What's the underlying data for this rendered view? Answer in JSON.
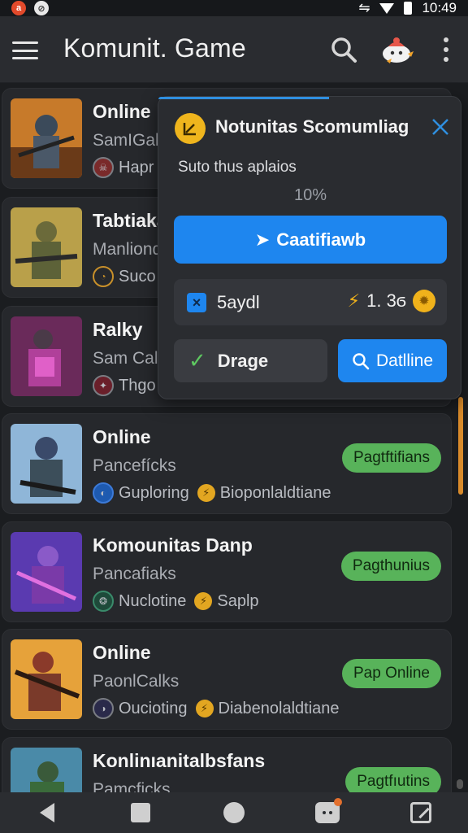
{
  "status_bar": {
    "time": "10:49"
  },
  "app_bar": {
    "title": "Komunit. Game",
    "icons": [
      "menu-icon",
      "search-icon",
      "mascot-icon",
      "more-vert-icon"
    ]
  },
  "cards": [
    {
      "title": "Online",
      "subtitle": "SamIGak",
      "meta": "Hapr",
      "status": ""
    },
    {
      "title": "Tabtiaka",
      "subtitle": "Manliond",
      "meta": "Suco",
      "status": ""
    },
    {
      "title": "Ralky",
      "subtitle": "Sam Cal",
      "meta": "Thgo",
      "status": ""
    },
    {
      "title": "Online",
      "subtitle": "Pancefícks",
      "meta": "Guploring",
      "meta2": "Bioponlaldtiane",
      "status": "Pagtftifians"
    },
    {
      "title": "Komounitas Danp",
      "subtitle": "Pancafiaks",
      "meta": "Nuclotine",
      "meta2": "Saplp",
      "status": "Pagthunius"
    },
    {
      "title": "Online",
      "subtitle": "PaonlCalks",
      "meta": "Oucioting",
      "meta2": "Diabenolaldtiane",
      "status": "Pap Online"
    },
    {
      "title": "Konlinıanitalbsfans",
      "subtitle": "Pamcficks",
      "meta": "",
      "meta2": "",
      "status": "Pagtfıutins"
    }
  ],
  "popup": {
    "title": "Notunitas Scomumliag",
    "text": "Suto thus aplaios",
    "progress": "10%",
    "progress_value": 0.1,
    "primary_button": "Caatifiawb",
    "row_label": "5aydl",
    "row_value": "1. 3ϭ",
    "secondary_button": "Drage",
    "blue_button": "Datlline"
  },
  "colors": {
    "accent_blue": "#1e86ef",
    "status_green": "#58b35a",
    "coin_gold": "#e2a621",
    "background": "#1b1d20"
  }
}
